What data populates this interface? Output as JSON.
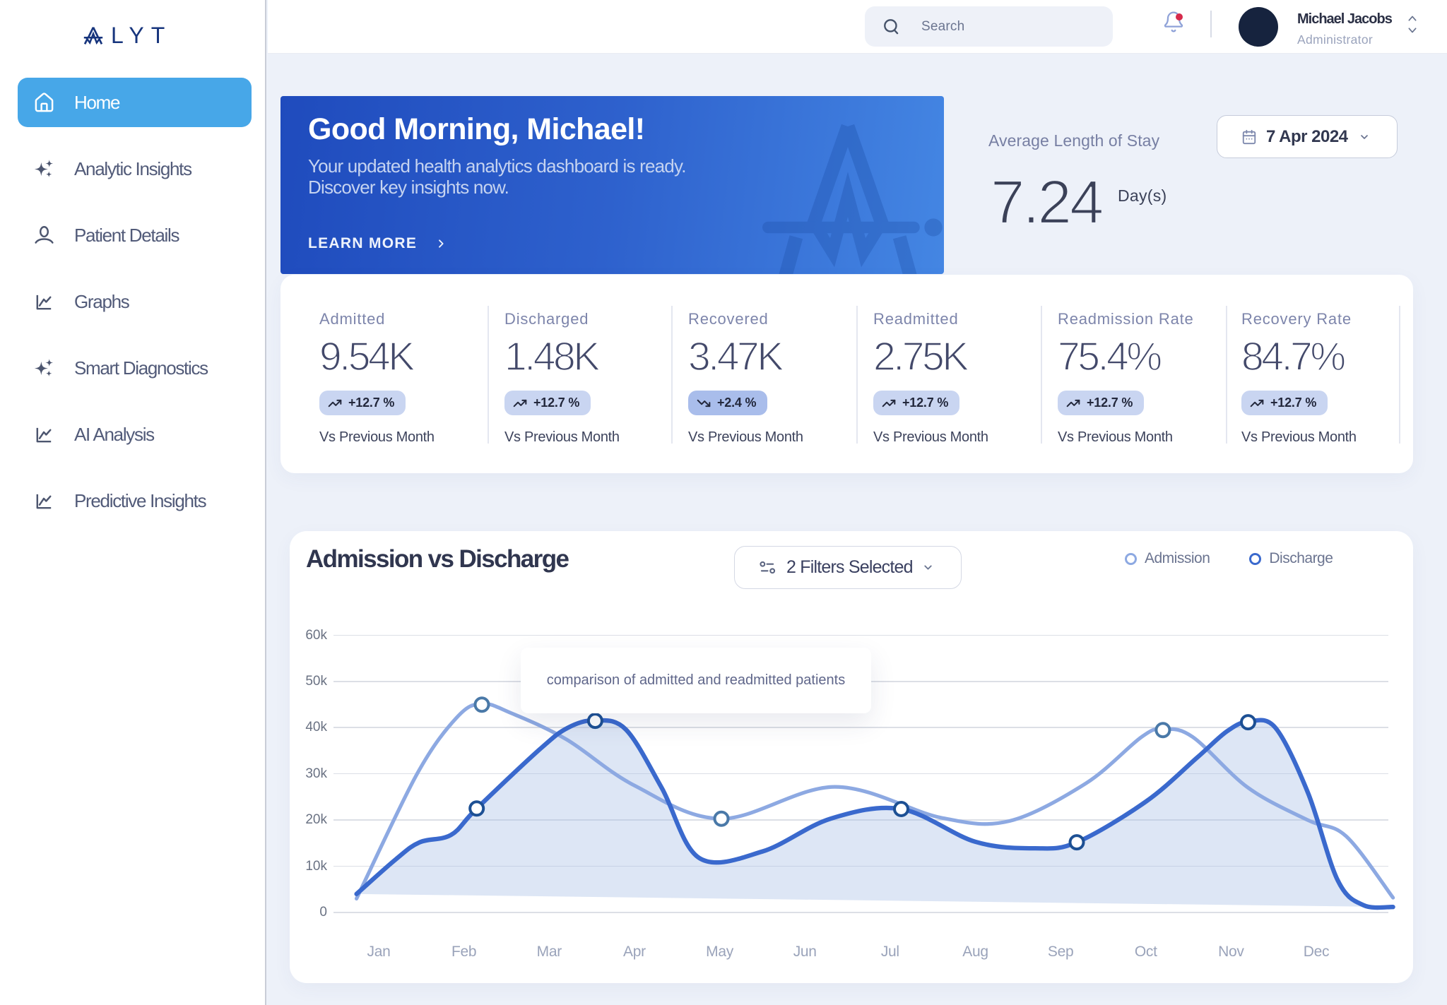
{
  "brand": {
    "letters": "LYT"
  },
  "sidebar": {
    "items": [
      {
        "icon": "home",
        "label": "Home",
        "active": true
      },
      {
        "icon": "sparkles",
        "label": "Analytic Insights",
        "active": false
      },
      {
        "icon": "user",
        "label": "Patient Details",
        "active": false
      },
      {
        "icon": "chart",
        "label": "Graphs",
        "active": false
      },
      {
        "icon": "sparkles",
        "label": "Smart Diagnostics",
        "active": false
      },
      {
        "icon": "chart",
        "label": "AI Analysis",
        "active": false
      },
      {
        "icon": "chart",
        "label": "Predictive Insights",
        "active": false
      }
    ]
  },
  "topbar": {
    "search_placeholder": "Search",
    "user": {
      "name": "Michael Jacobs",
      "role": "Administrator"
    }
  },
  "hero": {
    "title": "Good Morning, Michael!",
    "subtitle_line1": "Your updated health analytics dashboard is ready.",
    "subtitle_line2": "Discover key insights now.",
    "cta": "LEARN MORE"
  },
  "summary": {
    "label": "Average Length of Stay",
    "value": "7.24",
    "unit": "Day(s)",
    "date": "7 Apr 2024"
  },
  "stats": [
    {
      "label": "Admitted",
      "value": "9.54K",
      "delta": "+12.7 %",
      "direction": "up",
      "vs": "Vs Previous Month",
      "badge_color": "#c9d5f1"
    },
    {
      "label": "Discharged",
      "value": "1.48K",
      "delta": "+12.7 %",
      "direction": "up",
      "vs": "Vs Previous Month",
      "badge_color": "#c9d5f1"
    },
    {
      "label": "Recovered",
      "value": "3.47K",
      "delta": "+2.4 %",
      "direction": "down",
      "vs": "Vs Previous Month",
      "badge_color": "#a9bdeb"
    },
    {
      "label": "Readmitted",
      "value": "2.75K",
      "delta": "+12.7 %",
      "direction": "up",
      "vs": "Vs Previous Month",
      "badge_color": "#c9d5f1"
    },
    {
      "label": "Readmission Rate",
      "value": "75.4%",
      "delta": "+12.7 %",
      "direction": "up",
      "vs": "Vs Previous Month",
      "badge_color": "#c9d5f1"
    },
    {
      "label": "Recovery Rate",
      "value": "84.7%",
      "delta": "+12.7 %",
      "direction": "up",
      "vs": "Vs Previous Month",
      "badge_color": "#c9d5f1"
    }
  ],
  "chart": {
    "title": "Admission vs Discharge",
    "filters_label": "2 Filters Selected",
    "tooltip": "comparison of admitted and readmitted patients"
  },
  "chart_data": {
    "type": "line",
    "title": "Admission vs Discharge",
    "categories": [
      "Jan",
      "Feb",
      "Mar",
      "Apr",
      "May",
      "Jun",
      "Jul",
      "Aug",
      "Sep",
      "Oct",
      "Nov",
      "Dec"
    ],
    "y_ticks": [
      "0",
      "10k",
      "20k",
      "30k",
      "40k",
      "50k",
      "60k"
    ],
    "y_tick_values": [
      0,
      10,
      20,
      30,
      40,
      50,
      60
    ],
    "ylim": [
      0,
      60
    ],
    "unit": "thousands of patients",
    "grid": true,
    "legend_position": "top-right",
    "series": [
      {
        "name": "Admission",
        "color": "#8da9e2",
        "marker_color": "#4a79a8",
        "points": [
          {
            "x": -0.26,
            "y": 3.0
          },
          {
            "x": 0.45,
            "y": 30.0
          },
          {
            "x": 0.92,
            "y": 42.3
          },
          {
            "x": 1.21,
            "y": 45.2
          },
          {
            "x": 1.55,
            "y": 43.2
          },
          {
            "x": 2.2,
            "y": 37.5
          },
          {
            "x": 3.0,
            "y": 27.5
          },
          {
            "x": 4.02,
            "y": 20.3
          },
          {
            "x": 5.35,
            "y": 27.2
          },
          {
            "x": 6.6,
            "y": 20.5
          },
          {
            "x": 7.4,
            "y": 19.8
          },
          {
            "x": 8.3,
            "y": 28.0
          },
          {
            "x": 8.95,
            "y": 38.0
          },
          {
            "x": 9.2,
            "y": 39.7
          },
          {
            "x": 9.55,
            "y": 38.0
          },
          {
            "x": 10.2,
            "y": 27.0
          },
          {
            "x": 10.9,
            "y": 20.0
          },
          {
            "x": 11.35,
            "y": 16.5
          },
          {
            "x": 11.9,
            "y": 3.2
          }
        ],
        "markers": [
          {
            "x": 1.21,
            "y": 45.0
          },
          {
            "x": 4.02,
            "y": 20.3
          },
          {
            "x": 9.2,
            "y": 39.5
          }
        ]
      },
      {
        "name": "Discharge",
        "color": "#3a69cd",
        "marker_color": "#1d5094",
        "fill": true,
        "fill_color": "rgba(164,186,229,0.37)",
        "points": [
          {
            "x": -0.26,
            "y": 4.0
          },
          {
            "x": 0.2,
            "y": 11.5
          },
          {
            "x": 0.48,
            "y": 15.2
          },
          {
            "x": 0.85,
            "y": 16.8
          },
          {
            "x": 1.15,
            "y": 22.5
          },
          {
            "x": 1.9,
            "y": 35.5
          },
          {
            "x": 2.22,
            "y": 40.0
          },
          {
            "x": 2.54,
            "y": 41.6
          },
          {
            "x": 2.9,
            "y": 39.6
          },
          {
            "x": 3.32,
            "y": 27.0
          },
          {
            "x": 3.76,
            "y": 11.8
          },
          {
            "x": 4.5,
            "y": 13.2
          },
          {
            "x": 5.3,
            "y": 20.3
          },
          {
            "x": 6.13,
            "y": 22.4
          },
          {
            "x": 7.0,
            "y": 15.3
          },
          {
            "x": 7.7,
            "y": 13.9
          },
          {
            "x": 8.19,
            "y": 15.2
          },
          {
            "x": 9.0,
            "y": 24.0
          },
          {
            "x": 9.6,
            "y": 33.5
          },
          {
            "x": 9.95,
            "y": 39.2
          },
          {
            "x": 10.2,
            "y": 41.3
          },
          {
            "x": 10.52,
            "y": 40.0
          },
          {
            "x": 10.9,
            "y": 26.0
          },
          {
            "x": 11.25,
            "y": 7.0
          },
          {
            "x": 11.55,
            "y": 1.6
          },
          {
            "x": 11.9,
            "y": 1.2
          }
        ],
        "markers": [
          {
            "x": 1.15,
            "y": 22.5
          },
          {
            "x": 2.54,
            "y": 41.5
          },
          {
            "x": 6.13,
            "y": 22.4
          },
          {
            "x": 8.19,
            "y": 15.2
          },
          {
            "x": 10.2,
            "y": 41.2
          }
        ]
      }
    ]
  }
}
